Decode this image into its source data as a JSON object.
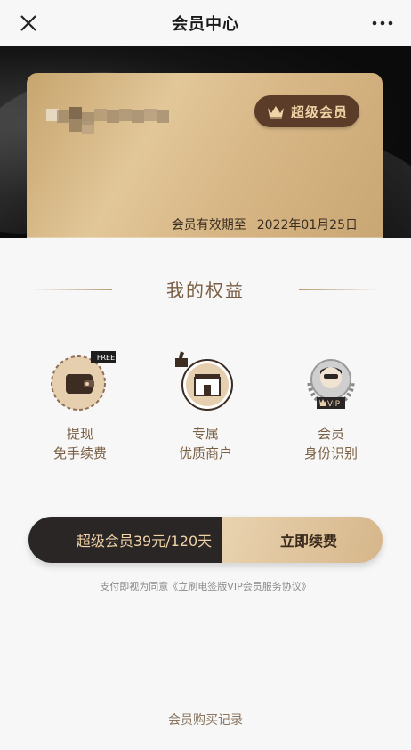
{
  "header": {
    "title": "会员中心",
    "close_icon": "close-icon",
    "more_icon": "more-icon"
  },
  "card": {
    "badge": "超级会员",
    "expiry_label": "会员有效期至",
    "expiry_date": "2022年01月25日"
  },
  "benefits": {
    "title": "我的权益",
    "items": [
      {
        "line1": "提现",
        "line2": "免手续费",
        "icon": "wallet-icon",
        "tag": "FREE"
      },
      {
        "line1": "专属",
        "line2": "优质商户",
        "icon": "store-icon"
      },
      {
        "line1": "会员",
        "line2": "身份识别",
        "icon": "vip-avatar-icon",
        "tag": "VIP"
      }
    ]
  },
  "purchase": {
    "plan": "超级会员39元/120天",
    "renew": "立即续费"
  },
  "agreement": "支付即视为同意《立刷电签版VIP会员服务协议》",
  "records": "会员购买记录",
  "colors": {
    "gold_text": "#7a5f44",
    "dark": "#2a2626",
    "badge_bg": "#5a3c28"
  }
}
